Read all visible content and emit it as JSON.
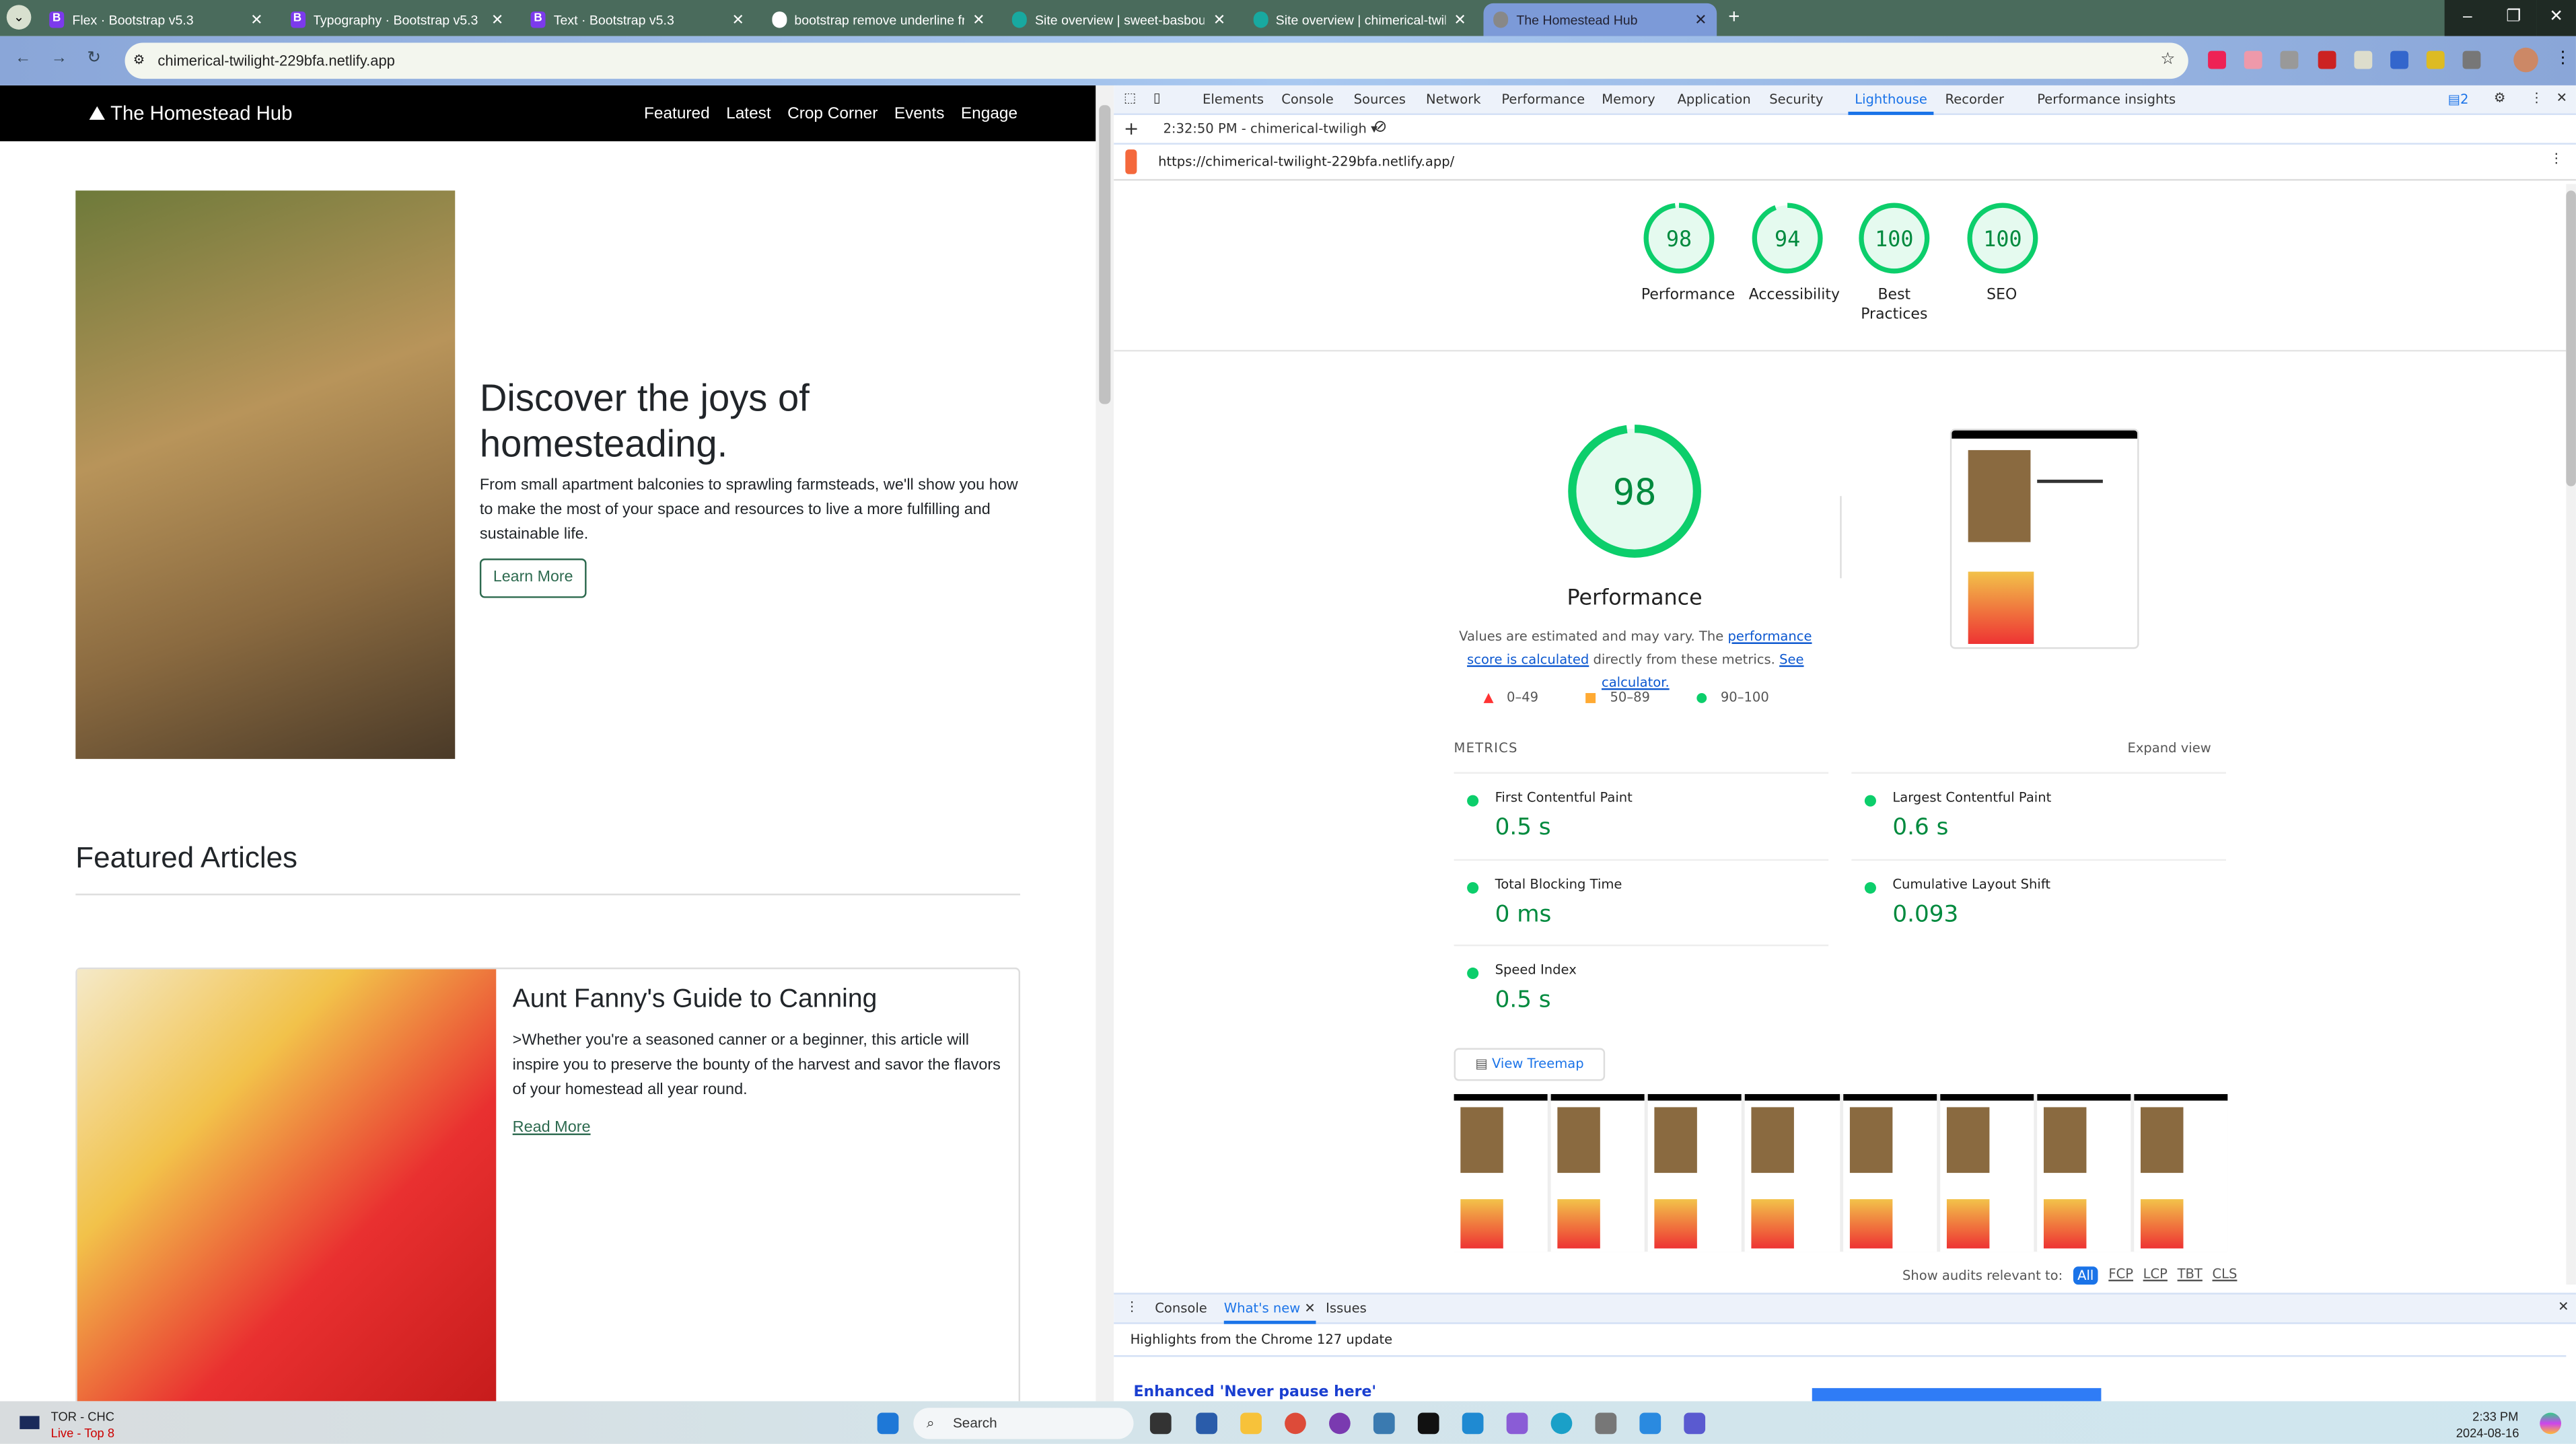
{
  "browser": {
    "tabs": [
      {
        "title": "Flex · Bootstrap v5.3",
        "icon": "bootstrap-icon"
      },
      {
        "title": "Typography · Bootstrap v5.3",
        "icon": "bootstrap-icon"
      },
      {
        "title": "Text · Bootstrap v5.3",
        "icon": "bootstrap-icon"
      },
      {
        "title": "bootstrap remove underline fro",
        "icon": "google-icon"
      },
      {
        "title": "Site overview | sweet-basbousa",
        "icon": "netlify-icon"
      },
      {
        "title": "Site overview | chimerical-twilig",
        "icon": "netlify-icon"
      },
      {
        "title": "The Homestead Hub",
        "icon": "globe-icon",
        "active": true
      }
    ],
    "url": "chimerical-twilight-229bfa.netlify.app"
  },
  "site": {
    "brand": "The Homestead Hub",
    "nav": [
      "Featured",
      "Latest",
      "Crop Corner",
      "Events",
      "Engage"
    ],
    "hero": {
      "title": "Discover the joys of homesteading.",
      "text": "From small apartment balconies to sprawling farmsteads, we'll show you how to make the most of your space and resources to live a more fulfilling and sustainable life.",
      "button": "Learn More"
    },
    "featured_heading": "Featured Articles",
    "article": {
      "title": "Aunt Fanny's Guide to Canning",
      "text": ">Whether you're a seasoned canner or a beginner, this article will inspire you to preserve the bounty of the harvest and savor the flavors of your homestead all year round.",
      "link": "Read More"
    }
  },
  "devtools": {
    "tabs": [
      "Elements",
      "Console",
      "Sources",
      "Network",
      "Performance",
      "Memory",
      "Application",
      "Security",
      "Lighthouse",
      "Recorder",
      "Performance insights"
    ],
    "active_tab": "Lighthouse",
    "issues_count": "2",
    "report_select": "2:32:50 PM - chimerical-twiligh",
    "report_url": "https://chimerical-twilight-229bfa.netlify.app/",
    "scores": [
      {
        "label": "Performance",
        "value": 98
      },
      {
        "label": "Accessibility",
        "value": 94
      },
      {
        "label": "Best Practices",
        "value": 100
      },
      {
        "label": "SEO",
        "value": 100
      }
    ],
    "main_score": {
      "label": "Performance",
      "value": 98
    },
    "desc_pre": "Values are estimated and may vary. The ",
    "desc_link1": "performance score is calculated",
    "desc_mid": " directly from these metrics. ",
    "desc_link2": "See calculator.",
    "legend": [
      {
        "range": "0–49",
        "color": "#ff3333"
      },
      {
        "range": "50–89",
        "color": "#ffaa33"
      },
      {
        "range": "90–100",
        "color": "#0cce6b"
      }
    ],
    "metrics_heading": "METRICS",
    "expand_view": "Expand view",
    "metrics": [
      {
        "label": "First Contentful Paint",
        "value": "0.5 s"
      },
      {
        "label": "Largest Contentful Paint",
        "value": "0.6 s"
      },
      {
        "label": "Total Blocking Time",
        "value": "0 ms"
      },
      {
        "label": "Cumulative Layout Shift",
        "value": "0.093"
      },
      {
        "label": "Speed Index",
        "value": "0.5 s"
      }
    ],
    "treemap": "View Treemap",
    "audits_label": "Show audits relevant to:",
    "audit_filters": [
      "All",
      "FCP",
      "LCP",
      "TBT",
      "CLS"
    ],
    "drawer_tabs": [
      "Console",
      "What's new",
      "Issues"
    ],
    "drawer_heading": "Highlights from the Chrome 127 update",
    "drawer_link": "Enhanced 'Never pause here'"
  },
  "taskbar": {
    "score_line1": "TOR - CHC",
    "score_line2": "Live - Top 8",
    "search": "Search",
    "time": "2:33 PM",
    "date": "2024-08-16"
  },
  "colors": {
    "pass": "#0cce6b",
    "accent": "#1a73e8",
    "site_green": "#2d6a4f"
  }
}
